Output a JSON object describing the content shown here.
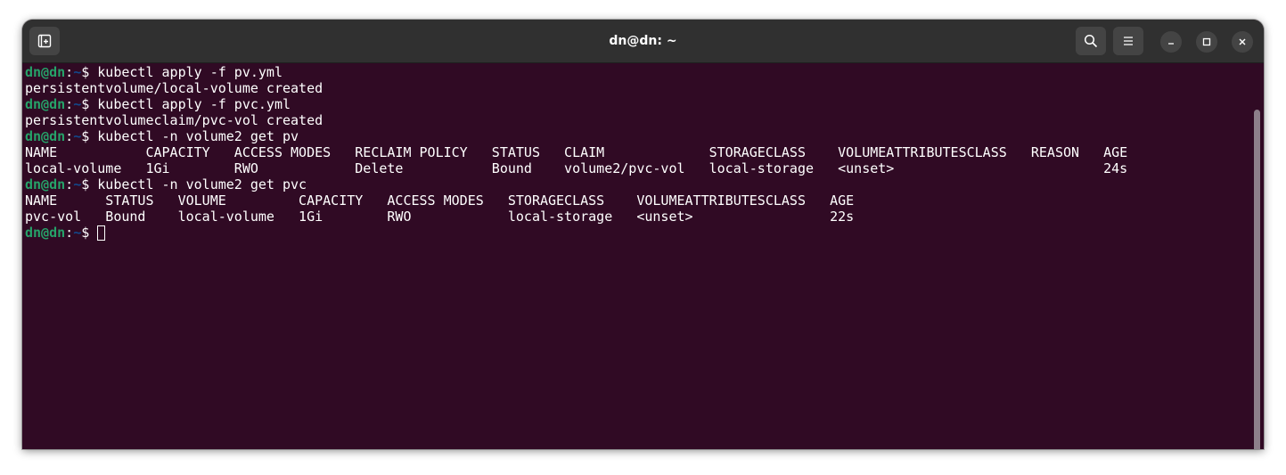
{
  "window": {
    "title": "dn@dn: ~"
  },
  "titlebar": {
    "buttons": [
      "new-tab-icon",
      "search-icon",
      "menu-icon",
      "minimize-icon",
      "maximize-icon",
      "close-icon"
    ]
  },
  "colors": {
    "terminal_bg": "#300a24",
    "prompt_user": "#26a269",
    "prompt_path": "#12488b",
    "text": "#ffffff",
    "titlebar_bg": "#303030"
  },
  "prompt": {
    "user_host": "dn@dn",
    "separator": ":",
    "path": "~",
    "symbol": "$ "
  },
  "terminal": {
    "lines": [
      {
        "type": "command",
        "text": "kubectl apply -f pv.yml"
      },
      {
        "type": "output",
        "text": "persistentvolume/local-volume created"
      },
      {
        "type": "command",
        "text": "kubectl apply -f pvc.yml"
      },
      {
        "type": "output",
        "text": "persistentvolumeclaim/pvc-vol created"
      },
      {
        "type": "command",
        "text": "kubectl -n volume2 get pv"
      },
      {
        "type": "output",
        "text": "NAME           CAPACITY   ACCESS MODES   RECLAIM POLICY   STATUS   CLAIM             STORAGECLASS    VOLUMEATTRIBUTESCLASS   REASON   AGE"
      },
      {
        "type": "output",
        "text": "local-volume   1Gi        RWO            Delete           Bound    volume2/pvc-vol   local-storage   <unset>                          24s"
      },
      {
        "type": "command",
        "text": "kubectl -n volume2 get pvc"
      },
      {
        "type": "output",
        "text": "NAME      STATUS   VOLUME         CAPACITY   ACCESS MODES   STORAGECLASS    VOLUMEATTRIBUTESCLASS   AGE"
      },
      {
        "type": "output",
        "text": "pvc-vol   Bound    local-volume   1Gi        RWO            local-storage   <unset>                 22s"
      },
      {
        "type": "command",
        "text": ""
      }
    ]
  }
}
